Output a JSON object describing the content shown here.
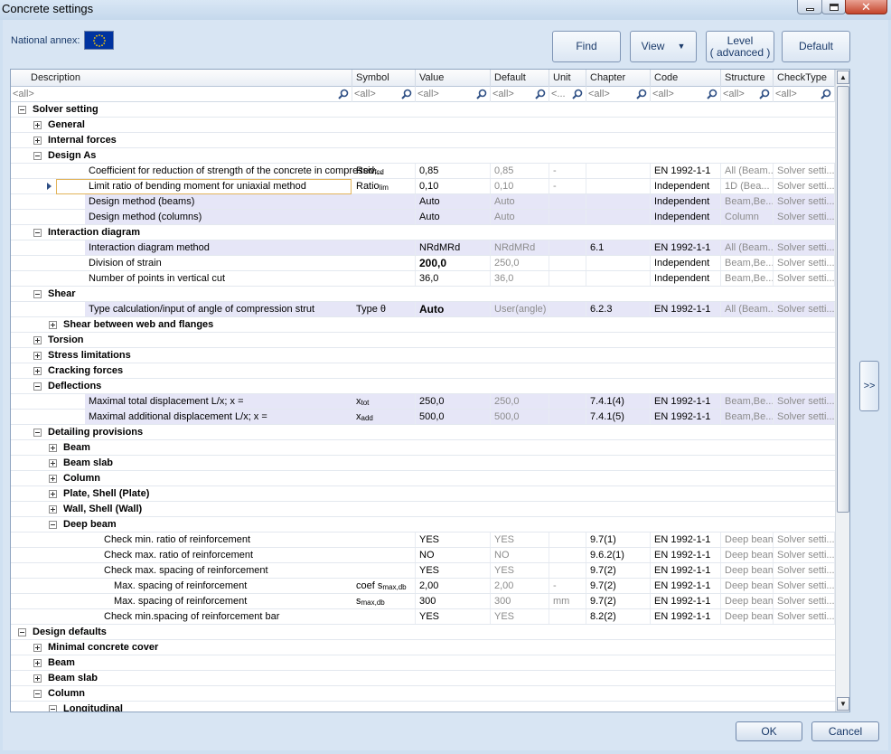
{
  "window": {
    "title": "Concrete settings"
  },
  "toolbar": {
    "annex_label": "National annex:",
    "find": "Find",
    "view": "View",
    "level_line1": "Level",
    "level_line2": "( advanced )",
    "default": "Default"
  },
  "columns": [
    "Description",
    "Symbol",
    "Value",
    "Default",
    "Unit",
    "Chapter",
    "Code",
    "Structure",
    "CheckType"
  ],
  "filters": {
    "description": "<all>",
    "symbol": "<all>",
    "value": "<all>",
    "default": "<all>",
    "unit": "<...",
    "chapter": "<all>",
    "code": "<all>",
    "structure": "<all>",
    "checktype": "<all>"
  },
  "rows": [
    {
      "level": 0,
      "toggle": "minus",
      "name": "Solver setting",
      "group": true
    },
    {
      "level": 1,
      "toggle": "plus",
      "name": "General",
      "group": true
    },
    {
      "level": 1,
      "toggle": "plus",
      "name": "Internal forces",
      "group": true
    },
    {
      "level": 1,
      "toggle": "minus",
      "name": "Design As",
      "group": true
    },
    {
      "level": 2,
      "name": "Coefficient for reduction of strength of the concrete in compressiv...",
      "symbol": "Red",
      "symbol_sub": "fcd",
      "value": "0,85",
      "default": "0,85",
      "unit": "-",
      "chapter": "",
      "code": "EN 1992-1-1",
      "structure": "All (Beam...",
      "checktype": "Solver setti..."
    },
    {
      "level": 2,
      "name": "Limit ratio of bending moment for uniaxial method",
      "symbol": "Ratio",
      "symbol_sub": "lim",
      "value": "0,10",
      "default": "0,10",
      "unit": "-",
      "chapter": "",
      "code": "Independent",
      "structure": "1D (Bea...",
      "checktype": "Solver setti...",
      "selected": true
    },
    {
      "level": 2,
      "name": "Design method (beams)",
      "value": "Auto",
      "default": "Auto",
      "code": "Independent",
      "structure": "Beam,Be...",
      "checktype": "Solver setti...",
      "hl": true
    },
    {
      "level": 2,
      "name": "Design method (columns)",
      "value": "Auto",
      "default": "Auto",
      "code": "Independent",
      "structure": "Column",
      "checktype": "Solver setti...",
      "hl": true
    },
    {
      "level": 1,
      "toggle": "minus",
      "name": "Interaction diagram",
      "group": true
    },
    {
      "level": 2,
      "name": "Interaction diagram method",
      "value": "NRdMRd",
      "default": "NRdMRd",
      "chapter": "6.1",
      "code": "EN 1992-1-1",
      "structure": "All (Beam...",
      "checktype": "Solver setti...",
      "hl": true
    },
    {
      "level": 2,
      "name": "Division of strain",
      "value": "200,0",
      "value_bold": true,
      "default": "250,0",
      "code": "Independent",
      "structure": "Beam,Be...",
      "checktype": "Solver setti..."
    },
    {
      "level": 2,
      "name": "Number of points in vertical cut",
      "value": "36,0",
      "default": "36,0",
      "code": "Independent",
      "structure": "Beam,Be...",
      "checktype": "Solver setti..."
    },
    {
      "level": 1,
      "toggle": "minus",
      "name": "Shear",
      "group": true
    },
    {
      "level": 2,
      "name": "Type calculation/input of angle of compression strut",
      "symbol": "Type θ",
      "value": "Auto",
      "value_bold": true,
      "default": "User(angle)",
      "chapter": "6.2.3",
      "code": "EN 1992-1-1",
      "structure": "All (Beam...",
      "checktype": "Solver setti...",
      "hl": true
    },
    {
      "level": 2,
      "toggle": "plus",
      "name": "Shear between web and flanges",
      "group": true
    },
    {
      "level": 1,
      "toggle": "plus",
      "name": "Torsion",
      "group": true
    },
    {
      "level": 1,
      "toggle": "plus",
      "name": "Stress limitations",
      "group": true
    },
    {
      "level": 1,
      "toggle": "plus",
      "name": "Cracking forces",
      "group": true
    },
    {
      "level": 1,
      "toggle": "minus",
      "name": "Deflections",
      "group": true
    },
    {
      "level": 2,
      "name": "Maximal total displacement L/x; x =",
      "symbol": "x",
      "symbol_sub": "tot",
      "value": "250,0",
      "default": "250,0",
      "chapter": "7.4.1(4)",
      "code": "EN 1992-1-1",
      "structure": "Beam,Be...",
      "checktype": "Solver setti...",
      "hl": true
    },
    {
      "level": 2,
      "name": "Maximal additional displacement L/x; x =",
      "symbol": "x",
      "symbol_sub": "add",
      "value": "500,0",
      "default": "500,0",
      "chapter": "7.4.1(5)",
      "code": "EN 1992-1-1",
      "structure": "Beam,Be...",
      "checktype": "Solver setti...",
      "hl": true
    },
    {
      "level": 1,
      "toggle": "minus",
      "name": "Detailing provisions",
      "group": true
    },
    {
      "level": 2,
      "toggle": "plus",
      "name": "Beam",
      "group": true
    },
    {
      "level": 2,
      "toggle": "plus",
      "name": "Beam slab",
      "group": true
    },
    {
      "level": 2,
      "toggle": "plus",
      "name": "Column",
      "group": true
    },
    {
      "level": 2,
      "toggle": "plus",
      "name": "Plate, Shell (Plate)",
      "group": true
    },
    {
      "level": 2,
      "toggle": "plus",
      "name": "Wall, Shell (Wall)",
      "group": true
    },
    {
      "level": 2,
      "toggle": "minus",
      "name": "Deep beam",
      "group": true
    },
    {
      "level": 3,
      "name": "Check min. ratio of reinforcement",
      "value": "YES",
      "default": "YES",
      "chapter": "9.7(1)",
      "code": "EN 1992-1-1",
      "structure": "Deep beam",
      "checktype": "Solver setti..."
    },
    {
      "level": 3,
      "name": "Check max. ratio of reinforcement",
      "value": "NO",
      "default": "NO",
      "chapter": "9.6.2(1)",
      "code": "EN 1992-1-1",
      "structure": "Deep beam",
      "checktype": "Solver setti..."
    },
    {
      "level": 3,
      "name": "Check max. spacing of reinforcement",
      "value": "YES",
      "default": "YES",
      "chapter": "9.7(2)",
      "code": "EN 1992-1-1",
      "structure": "Deep beam",
      "checktype": "Solver setti..."
    },
    {
      "level": 4,
      "name": "Max. spacing of reinforcement",
      "symbol": "coef s",
      "symbol_sub": "max,db",
      "value": "2,00",
      "default": "2,00",
      "unit": "-",
      "chapter": "9.7(2)",
      "code": "EN 1992-1-1",
      "structure": "Deep beam",
      "checktype": "Solver setti..."
    },
    {
      "level": 4,
      "name": "Max. spacing of reinforcement",
      "symbol": "s",
      "symbol_sub": "max,db",
      "value": "300",
      "default": "300",
      "unit": "mm",
      "chapter": "9.7(2)",
      "code": "EN 1992-1-1",
      "structure": "Deep beam",
      "checktype": "Solver setti..."
    },
    {
      "level": 3,
      "name": "Check min.spacing of reinforcement bar",
      "value": "YES",
      "default": "YES",
      "chapter": "8.2(2)",
      "code": "EN 1992-1-1",
      "structure": "Deep beam",
      "checktype": "Solver setti..."
    },
    {
      "level": 0,
      "toggle": "minus",
      "name": "Design defaults",
      "group": true
    },
    {
      "level": 1,
      "toggle": "plus",
      "name": "Minimal concrete cover",
      "group": true
    },
    {
      "level": 1,
      "toggle": "plus",
      "name": "Beam",
      "group": true
    },
    {
      "level": 1,
      "toggle": "plus",
      "name": "Beam slab",
      "group": true
    },
    {
      "level": 1,
      "toggle": "minus",
      "name": "Column",
      "group": true
    },
    {
      "level": 2,
      "toggle": "minus",
      "name": "Longitudinal",
      "group": true
    }
  ],
  "side_button": ">>",
  "footer": {
    "ok": "OK",
    "cancel": "Cancel"
  },
  "colors": {
    "highlight_row": "#e6e6f7",
    "selection_border": "#e2b45a",
    "flag": "#0033a0"
  }
}
